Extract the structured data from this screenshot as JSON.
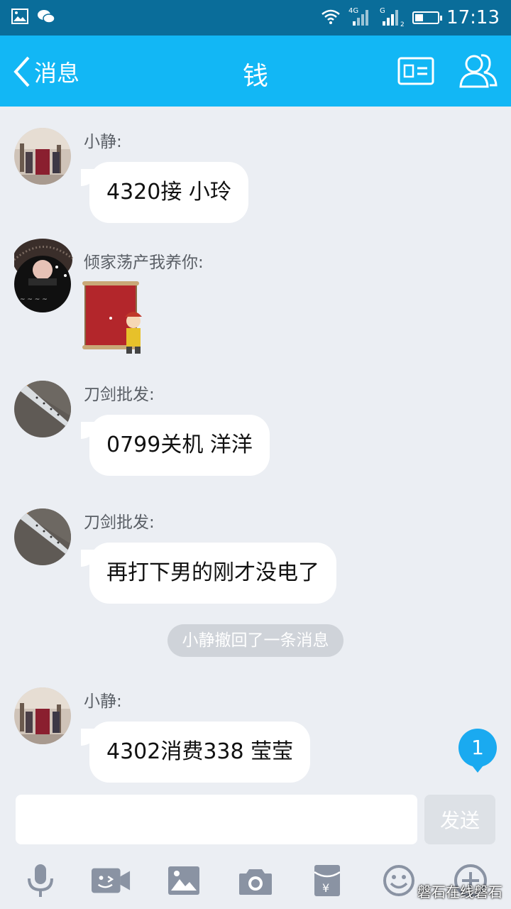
{
  "status_bar": {
    "left_icons": [
      "image-icon",
      "wechat-icon"
    ],
    "right_icons": [
      "wifi-icon",
      "signal-4g-icon",
      "signal-g-icon",
      "battery-icon"
    ],
    "network_labels": [
      "4G",
      "G"
    ],
    "battery_level": 0.35,
    "time": "17:13"
  },
  "header": {
    "back_label": "消息",
    "title": "钱",
    "right_icons": [
      "profile-card-icon",
      "group-members-icon"
    ],
    "background_color": "#12b7f5"
  },
  "messages": [
    {
      "sender": "小静:",
      "type": "text",
      "text": "4320接 小玲"
    },
    {
      "sender": "倾家荡产我养你:",
      "type": "sticker",
      "sticker": "scroll-emperor-sticker"
    },
    {
      "sender": "刀剑批发:",
      "type": "text",
      "text": "0799关机 洋洋"
    },
    {
      "sender": "刀剑批发:",
      "type": "text",
      "text": "再打下男的刚才没电了"
    },
    {
      "type": "system",
      "text": "小静撤回了一条消息"
    },
    {
      "sender": "小静:",
      "type": "text",
      "text": "4302消费338 莹莹"
    }
  ],
  "unread_count": "1",
  "input": {
    "value": "",
    "placeholder": ""
  },
  "send_label": "发送",
  "toolbar_icons": [
    "microphone-icon",
    "video-call-icon",
    "image-icon",
    "camera-icon",
    "red-packet-icon",
    "emoji-icon",
    "plus-icon"
  ],
  "watermark": "磐石在线磐石"
}
